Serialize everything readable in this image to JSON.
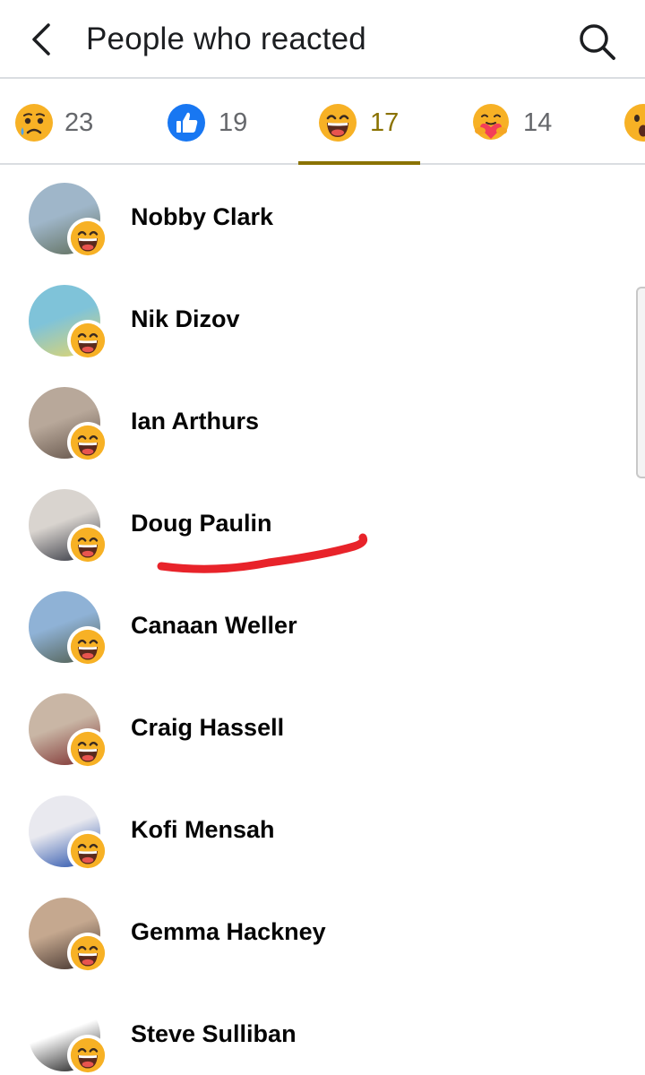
{
  "header": {
    "title": "People who reacted"
  },
  "tabs": [
    {
      "reaction": "sad",
      "icon": "sad-emoji-icon",
      "count": "23",
      "active": false
    },
    {
      "reaction": "like",
      "icon": "like-thumb-icon",
      "count": "19",
      "active": false
    },
    {
      "reaction": "haha",
      "icon": "laughing-emoji-icon",
      "count": "17",
      "active": true
    },
    {
      "reaction": "care",
      "icon": "hug-emoji-icon",
      "count": "14",
      "active": false
    },
    {
      "reaction": "wow",
      "icon": "wow-emoji-icon",
      "count": "",
      "active": false
    }
  ],
  "people": [
    {
      "name": "Nobby Clark",
      "reaction": "haha",
      "avatar_colors": [
        "#9fb6c9",
        "#5d6b57"
      ]
    },
    {
      "name": "Nik Dizov",
      "reaction": "haha",
      "avatar_colors": [
        "#7fc3d9",
        "#e4d66a"
      ]
    },
    {
      "name": "Ian Arthurs",
      "reaction": "haha",
      "avatar_colors": [
        "#b8a89a",
        "#5f4f45"
      ]
    },
    {
      "name": "Doug Paulin",
      "reaction": "haha",
      "avatar_colors": [
        "#d9d4cf",
        "#2c2f3a"
      ]
    },
    {
      "name": "Canaan Weller",
      "reaction": "haha",
      "avatar_colors": [
        "#8fb2d6",
        "#4e5a49"
      ]
    },
    {
      "name": "Craig Hassell",
      "reaction": "haha",
      "avatar_colors": [
        "#c9b6a5",
        "#7a2a2a"
      ]
    },
    {
      "name": "Kofi Mensah",
      "reaction": "haha",
      "avatar_colors": [
        "#e9e9ef",
        "#1e4aa8"
      ]
    },
    {
      "name": "Gemma Hackney",
      "reaction": "haha",
      "avatar_colors": [
        "#c5a88f",
        "#3b2c27"
      ]
    },
    {
      "name": "Steve Sulliban",
      "reaction": "haha",
      "avatar_colors": [
        "#ffffff",
        "#111111"
      ]
    }
  ],
  "colors": {
    "accent": "#8a7200",
    "annotation": "#e8232a"
  }
}
